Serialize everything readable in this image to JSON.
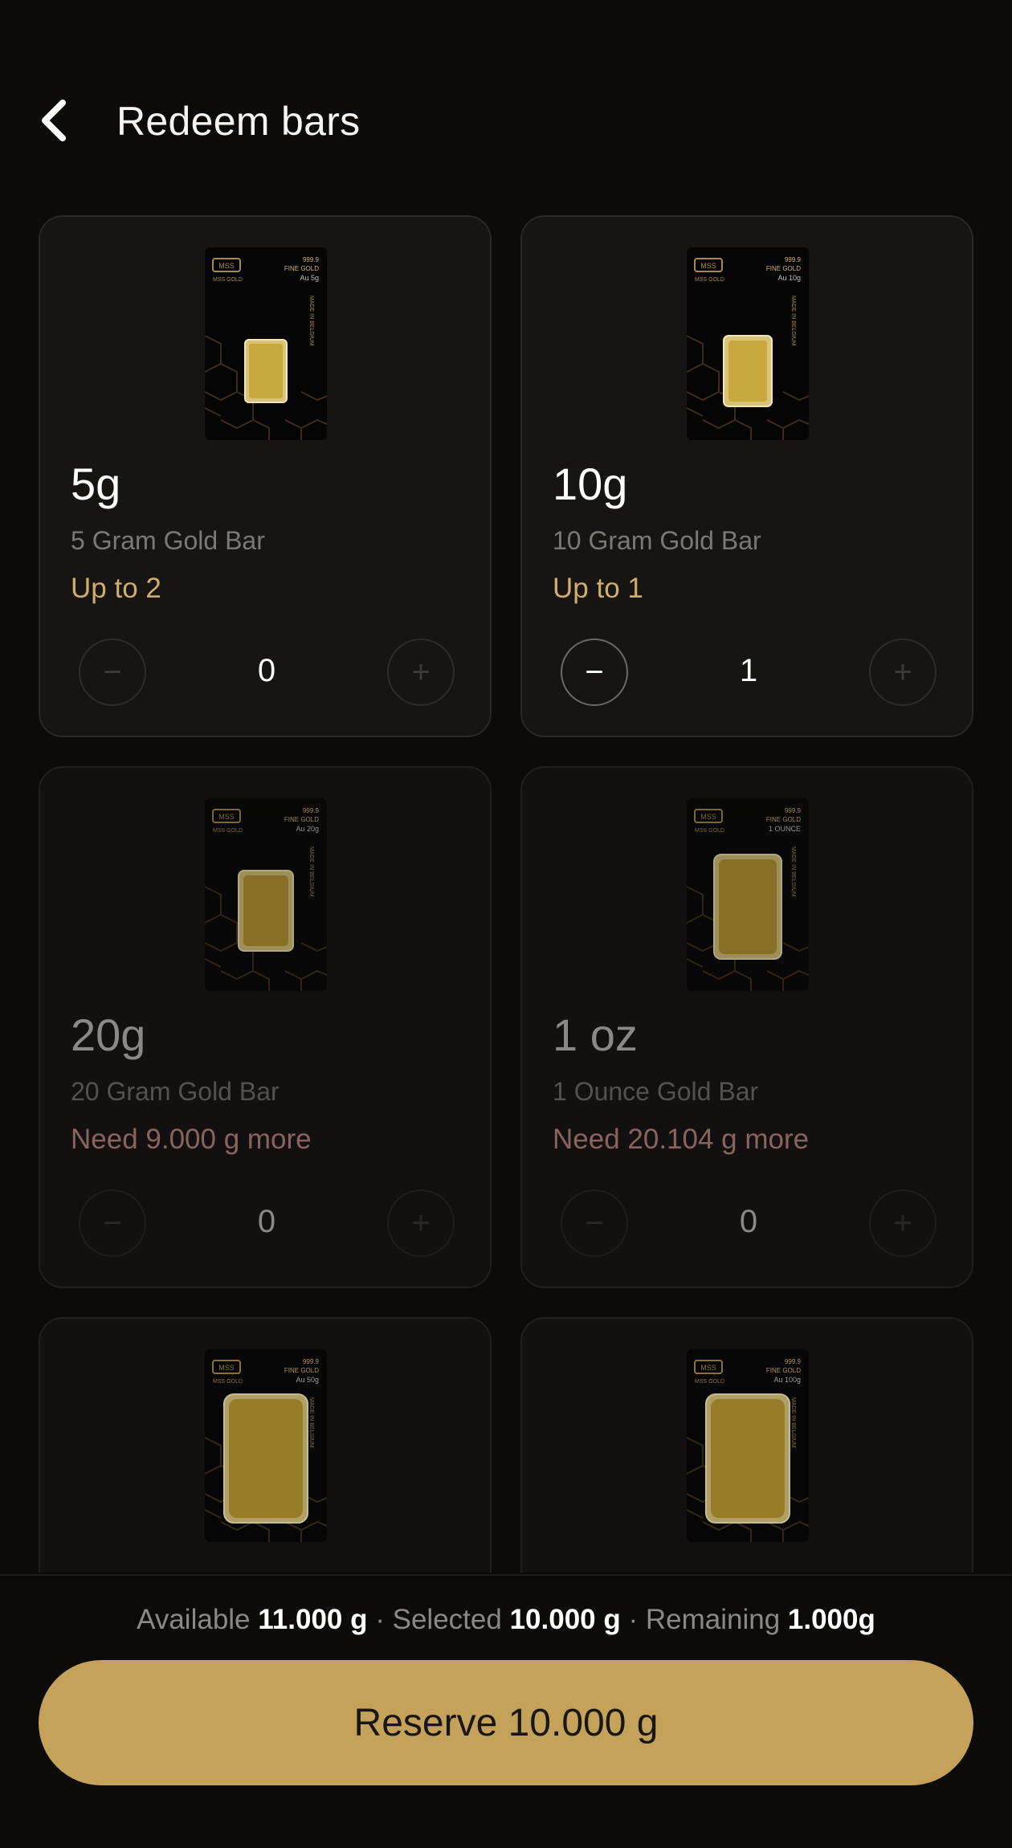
{
  "header": {
    "title": "Redeem bars"
  },
  "cards": [
    {
      "weight": "5g",
      "desc": "5 Gram Gold Bar",
      "status": "Up to 2",
      "qty": "0",
      "enabled": true,
      "pack": {
        "brand": "MSS",
        "brand_sub": "MSS GOLD",
        "purity": "999.9",
        "fine": "FINE GOLD",
        "mass": "Au 5g",
        "origin": "MADE IN BELGIUM"
      }
    },
    {
      "weight": "10g",
      "desc": "10 Gram Gold Bar",
      "status": "Up to 1",
      "qty": "1",
      "enabled": true,
      "pack": {
        "brand": "MSS",
        "brand_sub": "MSS GOLD",
        "purity": "999.9",
        "fine": "FINE GOLD",
        "mass": "Au 10g",
        "origin": "MADE IN BELGIUM"
      }
    },
    {
      "weight": "20g",
      "desc": "20 Gram Gold Bar",
      "status": "Need 9.000 g more",
      "qty": "0",
      "enabled": false,
      "pack": {
        "brand": "MSS",
        "brand_sub": "MSS GOLD",
        "purity": "999.9",
        "fine": "FINE GOLD",
        "mass": "Au 20g",
        "origin": "MADE IN BELGIUM"
      }
    },
    {
      "weight": "1 oz",
      "desc": "1 Ounce Gold Bar",
      "status": "Need 20.104 g more",
      "qty": "0",
      "enabled": false,
      "pack": {
        "brand": "MSS",
        "brand_sub": "MSS GOLD",
        "purity": "999.9",
        "fine": "FINE GOLD",
        "mass": "1 OUNCE",
        "origin": "MADE IN BELGIUM"
      }
    },
    {
      "weight": "",
      "desc": "",
      "status": "",
      "qty": "",
      "enabled": false,
      "pack": {
        "brand": "MSS",
        "brand_sub": "MSS GOLD",
        "purity": "999.9",
        "fine": "FINE GOLD",
        "mass": "Au 50g",
        "origin": "MADE IN BELGIUM"
      }
    },
    {
      "weight": "",
      "desc": "",
      "status": "",
      "qty": "",
      "enabled": false,
      "pack": {
        "brand": "MSS",
        "brand_sub": "MSS GOLD",
        "purity": "999.9",
        "fine": "FINE GOLD",
        "mass": "Au 100g",
        "origin": "MADE IN BELGIUM"
      }
    }
  ],
  "summary": {
    "available_label": "Available",
    "available_value": "11.000 g",
    "selected_label": "Selected",
    "selected_value": "10.000 g",
    "remaining_label": "Remaining",
    "remaining_value": "1.000g",
    "separator": "·"
  },
  "reserve_button": {
    "label": "Reserve 10.000 g"
  },
  "colors": {
    "gold": "#c4a25a",
    "status_ok": "#d1ad67",
    "status_need": "#8a6361",
    "background": "#0c0b0a"
  }
}
